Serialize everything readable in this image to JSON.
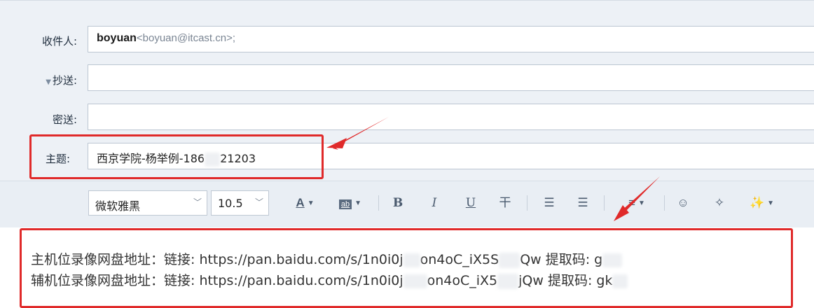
{
  "header": {
    "to_label": "收件人:",
    "to_name": "boyuan",
    "to_address": "<boyuan@itcast.cn>;",
    "cc_label": "抄送:",
    "cc_toggle": "▼",
    "cc_value": "",
    "bcc_label": "密送:",
    "bcc_value": "",
    "subject_label": "主题:",
    "subject_part1": "西京学院-杨举例-186",
    "subject_part2": "21203"
  },
  "toolbar": {
    "font_family": "微软雅黑",
    "font_size": "10.5",
    "font_color_label": "A",
    "highlight_label": "ab",
    "bold_label": "B",
    "italic_label": "I",
    "underline_label": "U",
    "strike_label": "干",
    "bullet_list_icon": "☰",
    "numbered_list_icon": "☰",
    "emoji_icon": "☺",
    "clear_format_icon": "✧",
    "magic_icon": "✨"
  },
  "body": {
    "line1_prefix": "主机位录像网盘地址：链接: https://pan.baidu.com/s/1n0i0j",
    "line1_mid": "on4oC_iX5S",
    "line1_end": "Qw 提取码: g",
    "line2_prefix": "辅机位录像网盘地址：链接: https://pan.baidu.com/s/1n0i0j",
    "line2_mid": "on4oC_iX5",
    "line2_end": "jQw 提取码: gk"
  },
  "colors": {
    "highlight": "#e02a2a",
    "header_bg": "#edf1f6",
    "toolbar_bg": "#e9eef4"
  }
}
